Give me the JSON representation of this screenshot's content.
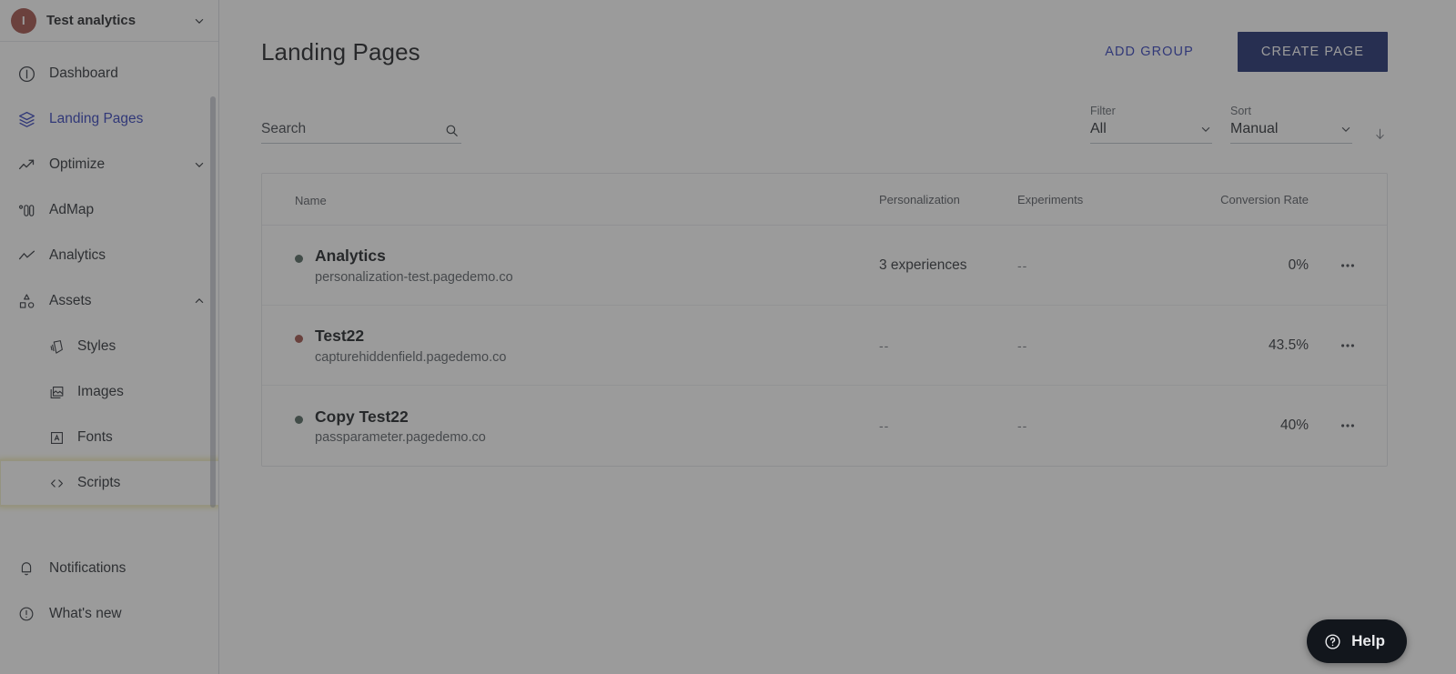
{
  "sidebar": {
    "org": {
      "avatar_initial": "I",
      "name": "Test analytics",
      "chevron": "chevron-down-icon"
    },
    "items": [
      {
        "label": "Dashboard",
        "icon": "dashboard-icon",
        "active": false,
        "expandable": false
      },
      {
        "label": "Landing Pages",
        "icon": "layers-icon",
        "active": true,
        "expandable": false
      },
      {
        "label": "Optimize",
        "icon": "trend-up-icon",
        "active": false,
        "expandable": true
      },
      {
        "label": "AdMap",
        "icon": "admap-icon",
        "active": false,
        "expandable": false
      },
      {
        "label": "Analytics",
        "icon": "line-chart-icon",
        "active": false,
        "expandable": false
      },
      {
        "label": "Assets",
        "icon": "shapes-icon",
        "active": false,
        "expandable": true
      }
    ],
    "assets_children": [
      {
        "label": "Styles",
        "icon": "styles-icon",
        "focused": false
      },
      {
        "label": "Images",
        "icon": "images-icon",
        "focused": false
      },
      {
        "label": "Fonts",
        "icon": "fonts-icon",
        "focused": false
      },
      {
        "label": "Scripts",
        "icon": "code-icon",
        "focused": true
      }
    ],
    "bottom_items": [
      {
        "label": "Notifications",
        "icon": "bell-icon"
      },
      {
        "label": "What's new",
        "icon": "info-circle-icon"
      }
    ]
  },
  "header": {
    "title": "Landing Pages",
    "add_group_label": "ADD GROUP",
    "create_page_label": "CREATE PAGE"
  },
  "toolbar": {
    "search_placeholder": "Search",
    "search_value": "",
    "search_icon": "search-icon",
    "filter_label": "Filter",
    "filter_value": "All",
    "sort_label": "Sort",
    "sort_value": "Manual",
    "sort_direction_icon": "arrow-down-icon"
  },
  "table": {
    "columns": {
      "name": "Name",
      "personalization": "Personalization",
      "experiments": "Experiments",
      "conversion_rate": "Conversion Rate"
    },
    "rows": [
      {
        "name": "Analytics",
        "url": "personalization-test.pagedemo.co",
        "status_color": "#4b6158",
        "personalization": "3 experiences",
        "experiments": "--",
        "conversion_rate": "0%",
        "menu_icon": "more-horizontal-icon"
      },
      {
        "name": "Test22",
        "url": "capturehiddenfield.pagedemo.co",
        "status_color": "#9b4b42",
        "personalization": "--",
        "experiments": "--",
        "conversion_rate": "43.5%",
        "menu_icon": "more-horizontal-icon"
      },
      {
        "name": "Copy Test22",
        "url": "passparameter.pagedemo.co",
        "status_color": "#4b6158",
        "personalization": "--",
        "experiments": "--",
        "conversion_rate": "40%",
        "menu_icon": "more-horizontal-icon"
      }
    ]
  },
  "help": {
    "label": "Help",
    "icon": "question-circle-icon"
  },
  "colors": {
    "accent": "#2a39b8",
    "primary_button": "#16266b",
    "avatar": "#9e4b42",
    "status_green": "#4b6158",
    "status_red": "#9b4b42",
    "scrim": "rgba(56,56,56,0.50)",
    "focus_ring": "#ece6a0"
  }
}
